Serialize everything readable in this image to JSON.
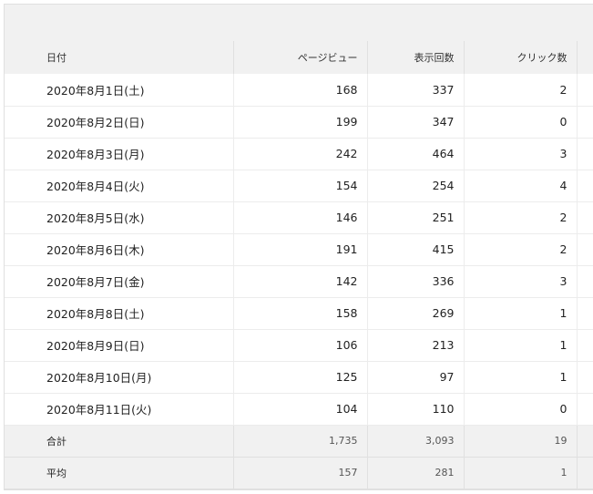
{
  "table": {
    "headers": [
      "日付",
      "ページビュー",
      "表示回数",
      "クリック数"
    ],
    "rows": [
      [
        "2020年8月1日(土)",
        "168",
        "337",
        "2"
      ],
      [
        "2020年8月2日(日)",
        "199",
        "347",
        "0"
      ],
      [
        "2020年8月3日(月)",
        "242",
        "464",
        "3"
      ],
      [
        "2020年8月4日(火)",
        "154",
        "254",
        "4"
      ],
      [
        "2020年8月5日(水)",
        "146",
        "251",
        "2"
      ],
      [
        "2020年8月6日(木)",
        "191",
        "415",
        "2"
      ],
      [
        "2020年8月7日(金)",
        "142",
        "336",
        "3"
      ],
      [
        "2020年8月8日(土)",
        "158",
        "269",
        "1"
      ],
      [
        "2020年8月9日(日)",
        "106",
        "213",
        "1"
      ],
      [
        "2020年8月10日(月)",
        "125",
        "97",
        "1"
      ],
      [
        "2020年8月11日(火)",
        "104",
        "110",
        "0"
      ]
    ],
    "total": [
      "合計",
      "1,735",
      "3,093",
      "19"
    ],
    "average": [
      "平均",
      "157",
      "281",
      "1"
    ]
  },
  "colors": {
    "header_bg": "#f1f1f1",
    "border": "#e0e0e0"
  }
}
